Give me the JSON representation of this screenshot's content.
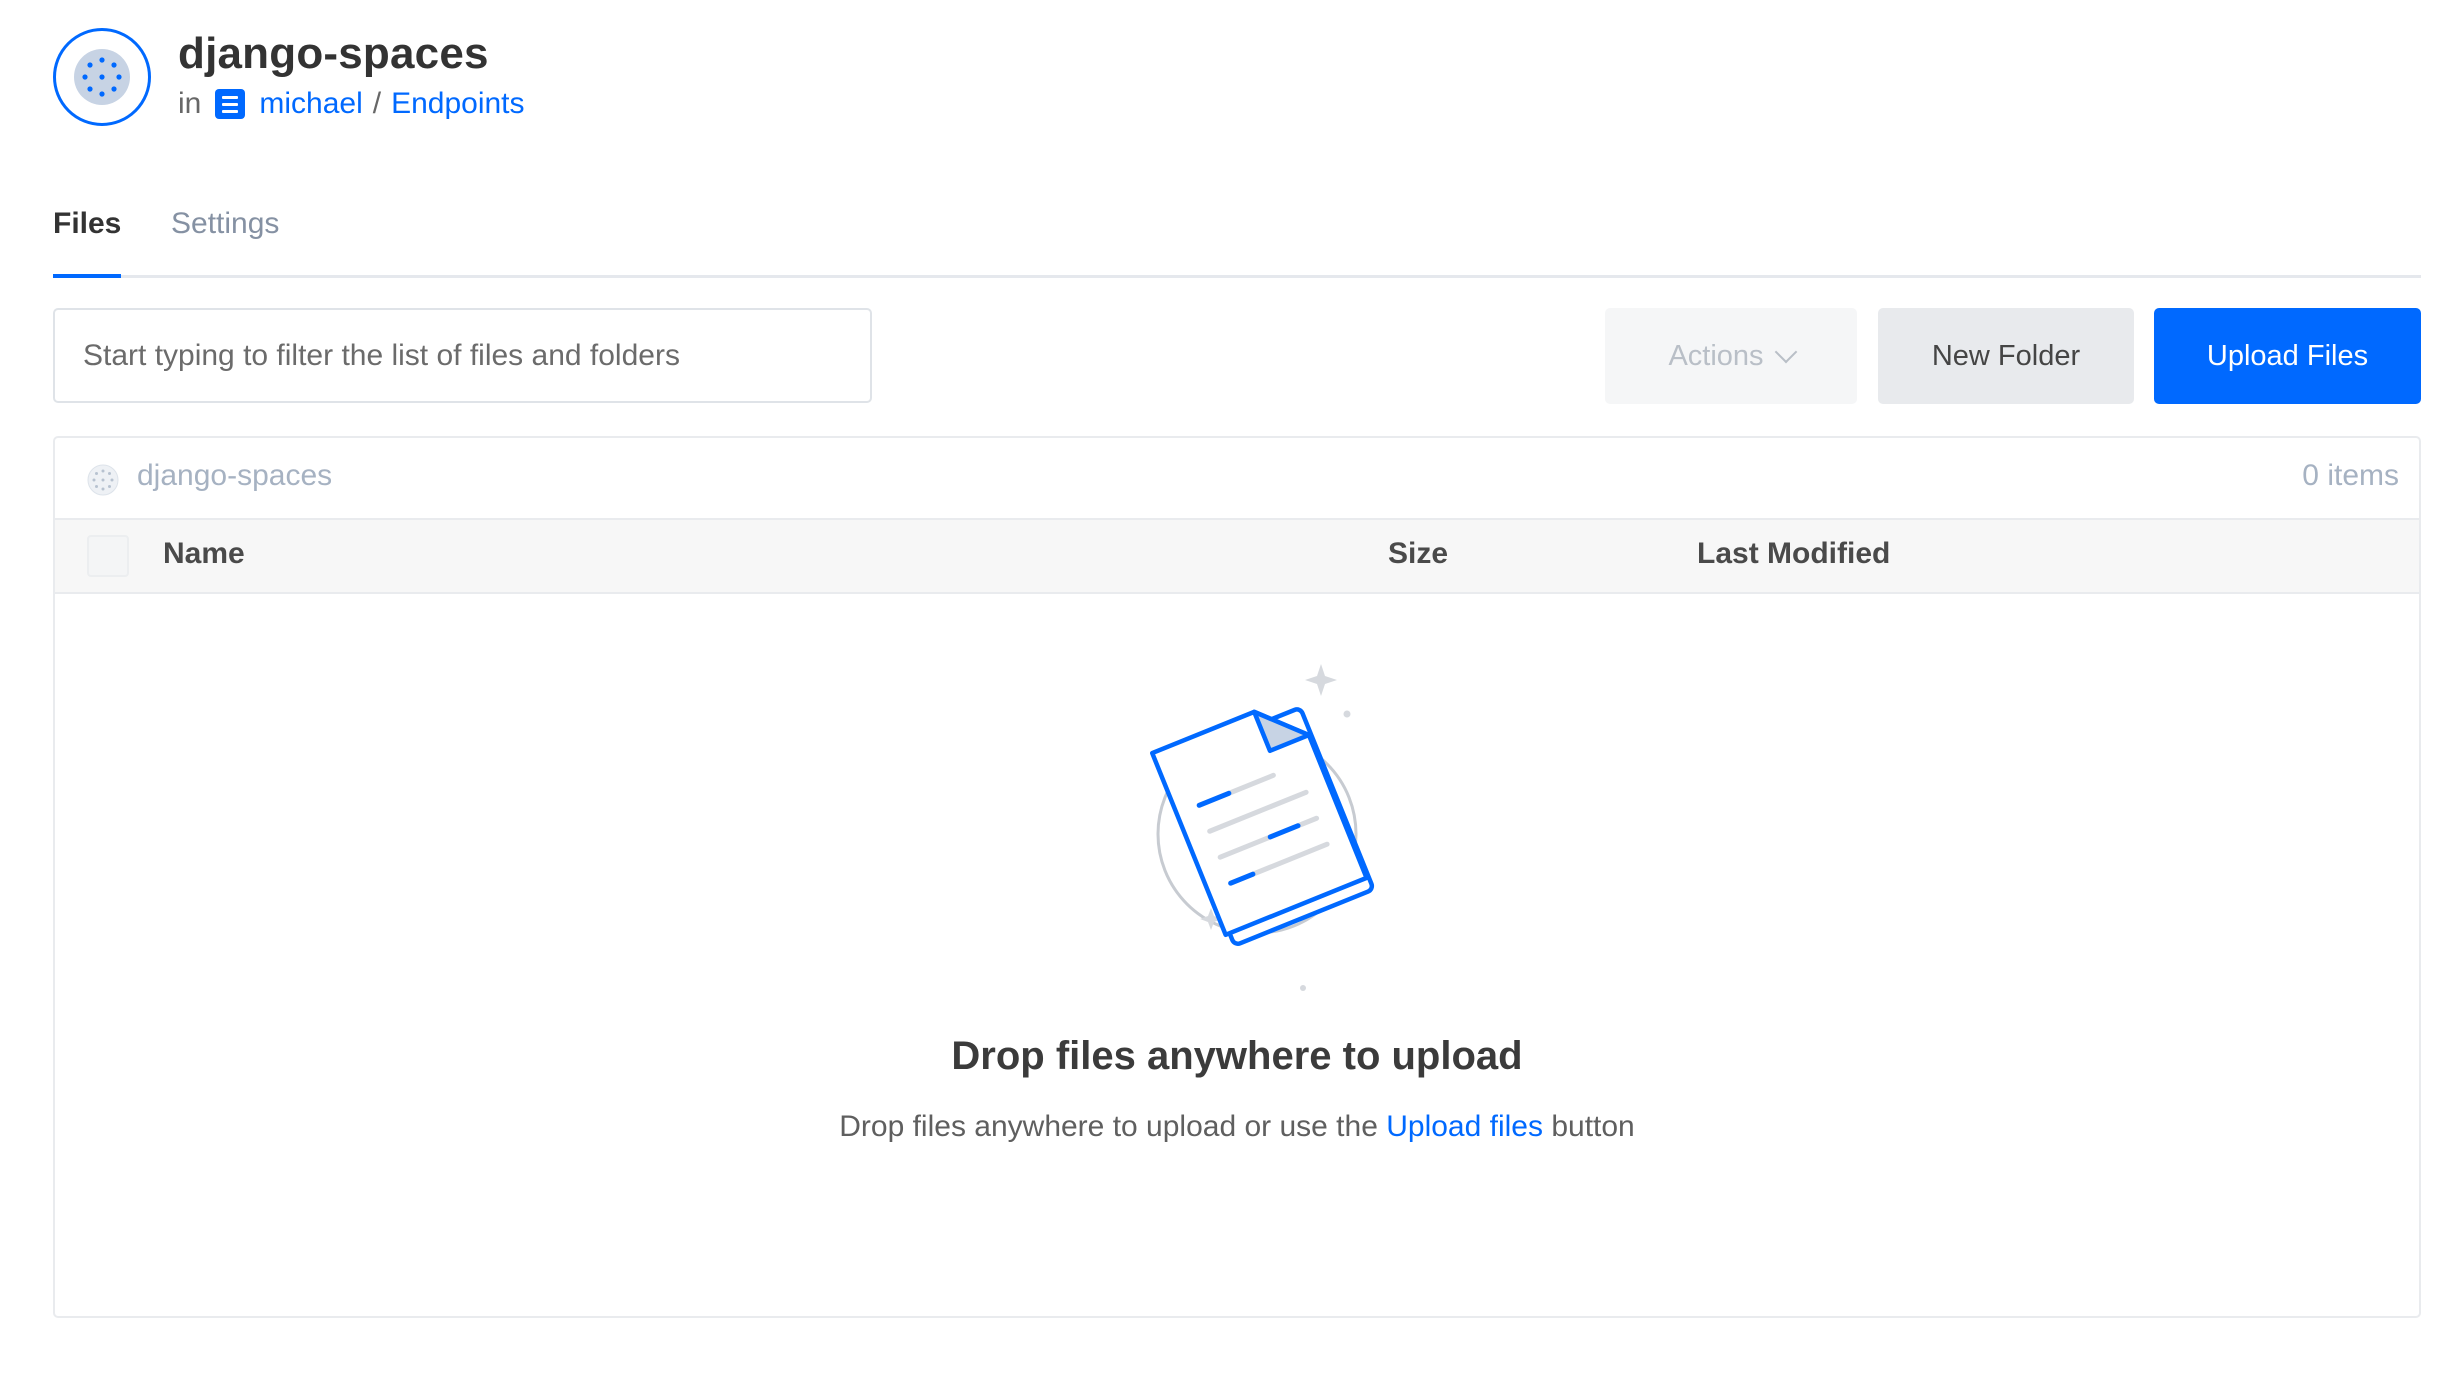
{
  "header": {
    "title": "django-spaces",
    "breadcrumb": {
      "prefix": "in",
      "project": "michael",
      "separator": "/",
      "section": "Endpoints"
    }
  },
  "tabs": [
    {
      "label": "Files",
      "active": true
    },
    {
      "label": "Settings",
      "active": false
    }
  ],
  "toolbar": {
    "filter_placeholder": "Start typing to filter the list of files and folders",
    "filter_value": "",
    "actions_label": "Actions",
    "new_folder_label": "New Folder",
    "upload_label": "Upload Files"
  },
  "panel": {
    "space_name": "django-spaces",
    "item_count": "0 items",
    "columns": {
      "name": "Name",
      "size": "Size",
      "last_modified": "Last Modified"
    },
    "empty": {
      "title": "Drop files anywhere to upload",
      "text_before": "Drop files anywhere to upload or use the ",
      "link": "Upload files",
      "text_after": " button"
    }
  },
  "icons": {
    "space_avatar": "spaces-icon",
    "project_icon": "project-icon",
    "actions_chevron": "chevron-down-icon",
    "empty_illustration": "documents-illustration"
  },
  "colors": {
    "accent": "#0069ff",
    "muted": "#a6b2c2",
    "border": "#e9ebee"
  }
}
